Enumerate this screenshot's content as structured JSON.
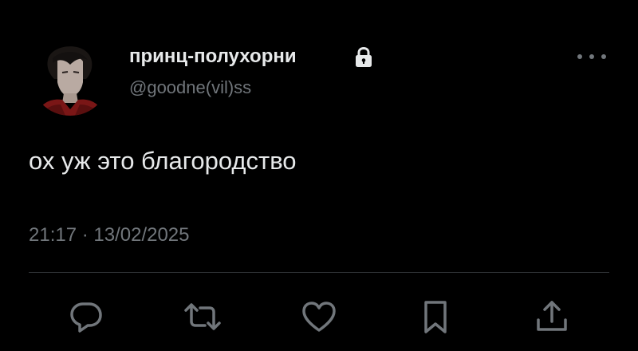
{
  "header": {
    "display_name": "принц-полухорни",
    "handle": "@goodne(vil)ss",
    "protected_icon": "lock-icon",
    "more_icon": "more-horizontal-icon"
  },
  "tweet": {
    "text": "ох уж это благородство",
    "timestamp": "21:17 · 13/02/2025"
  },
  "actions": [
    {
      "name": "reply",
      "icon": "reply-icon"
    },
    {
      "name": "retweet",
      "icon": "retweet-icon"
    },
    {
      "name": "like",
      "icon": "heart-icon"
    },
    {
      "name": "bookmark",
      "icon": "bookmark-icon"
    },
    {
      "name": "share",
      "icon": "share-icon"
    }
  ],
  "colors": {
    "background": "#000000",
    "primary_text": "#e7e9ea",
    "secondary_text": "#71767b",
    "divider": "#2f3336"
  }
}
